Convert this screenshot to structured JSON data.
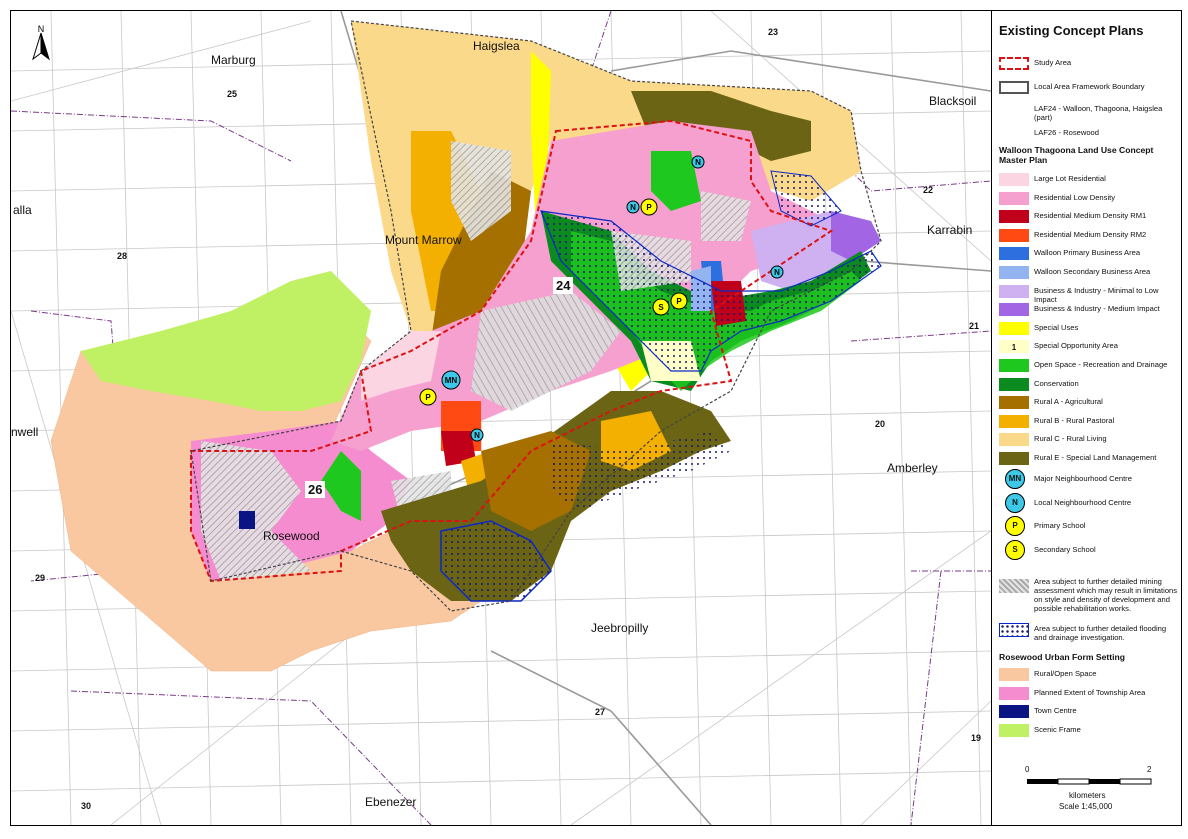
{
  "legend": {
    "title": "Existing Concept Plans",
    "study_area": "Study Area",
    "laf_boundary": "Local Area Framework Boundary",
    "laf24": "LAF24 - Walloon, Thagoona, Haigslea (part)",
    "laf26": "LAF26 - Rosewood",
    "walloon_heading": "Walloon Thagoona Land Use Concept Master Plan",
    "landuse": [
      {
        "label": "Large Lot Residential",
        "color": "#fbd5e2"
      },
      {
        "label": "Residential Low Density",
        "color": "#f5a0cf"
      },
      {
        "label": "Residential Medium Density RM1",
        "color": "#c0001a"
      },
      {
        "label": "Residential Medium Density RM2",
        "color": "#ff4a14"
      },
      {
        "label": "Walloon Primary Business Area",
        "color": "#2e6fe0"
      },
      {
        "label": "Walloon Secondary Business Area",
        "color": "#93b4f0"
      },
      {
        "label": "Business & Industry - Minimal to Low Impact",
        "color": "#cfb1f2"
      },
      {
        "label": "Business & Industry - Medium Impact",
        "color": "#a266e4"
      },
      {
        "label": "Special Uses",
        "color": "#ffff00"
      },
      {
        "label": "Special Opportunity Area",
        "color": "#ffffc8"
      },
      {
        "label": "Open Space - Recreation and Drainage",
        "color": "#1ec81e"
      },
      {
        "label": "Conservation",
        "color": "#0b8a20"
      },
      {
        "label": "Rural A - Agricultural",
        "color": "#a57000"
      },
      {
        "label": "Rural B - Rural Pastoral",
        "color": "#f4b000"
      },
      {
        "label": "Rural C - Rural Living",
        "color": "#fbd98b"
      },
      {
        "label": "Rural E - Special Land Management",
        "color": "#6b6414"
      }
    ],
    "special_opportunity_number": "1",
    "symbols": [
      {
        "code": "MN",
        "label": "Major Neighbourhood Centre",
        "color": "#3cc8e6"
      },
      {
        "code": "N",
        "label": "Local Neighbourhood Centre",
        "color": "#3cc8e6"
      },
      {
        "code": "P",
        "label": "Primary School",
        "color": "#ffff00"
      },
      {
        "code": "S",
        "label": "Secondary School",
        "color": "#ffff00"
      }
    ],
    "mining_note": "Area subject to further detailed mining assessment which may result in limitations on style and density of development and possible rehabilitation works.",
    "flood_note": "Area subject to further detailed flooding and drainage investigation.",
    "rosewood_heading": "Rosewood Urban Form Setting",
    "rosewood": [
      {
        "label": "Rural/Open Space",
        "color": "#fac8a0"
      },
      {
        "label": "Planned Extent of Township Area",
        "color": "#f58cd0"
      },
      {
        "label": "Town Centre",
        "color": "#0a1482"
      },
      {
        "label": "Scenic Frame",
        "color": "#c0f064"
      }
    ],
    "scale": {
      "zero": "0",
      "two": "2",
      "unit": "kilometers",
      "ratio": "Scale 1:45,000"
    }
  },
  "map": {
    "north": "N",
    "places": [
      "Haigslea",
      "Marburg",
      "Blacksoil",
      "Karrabin",
      "Mount Marrow",
      "Amberley",
      "Rosewood",
      "Jeebropilly",
      "Ebenezer",
      "alla",
      "nwell"
    ],
    "districts": [
      "23",
      "25",
      "22",
      "28",
      "21",
      "20",
      "29",
      "27",
      "19",
      "30"
    ],
    "zones": [
      "24",
      "26"
    ],
    "markers": [
      "N",
      "P",
      "N",
      "S",
      "P",
      "N",
      "MN",
      "P",
      "N"
    ]
  }
}
